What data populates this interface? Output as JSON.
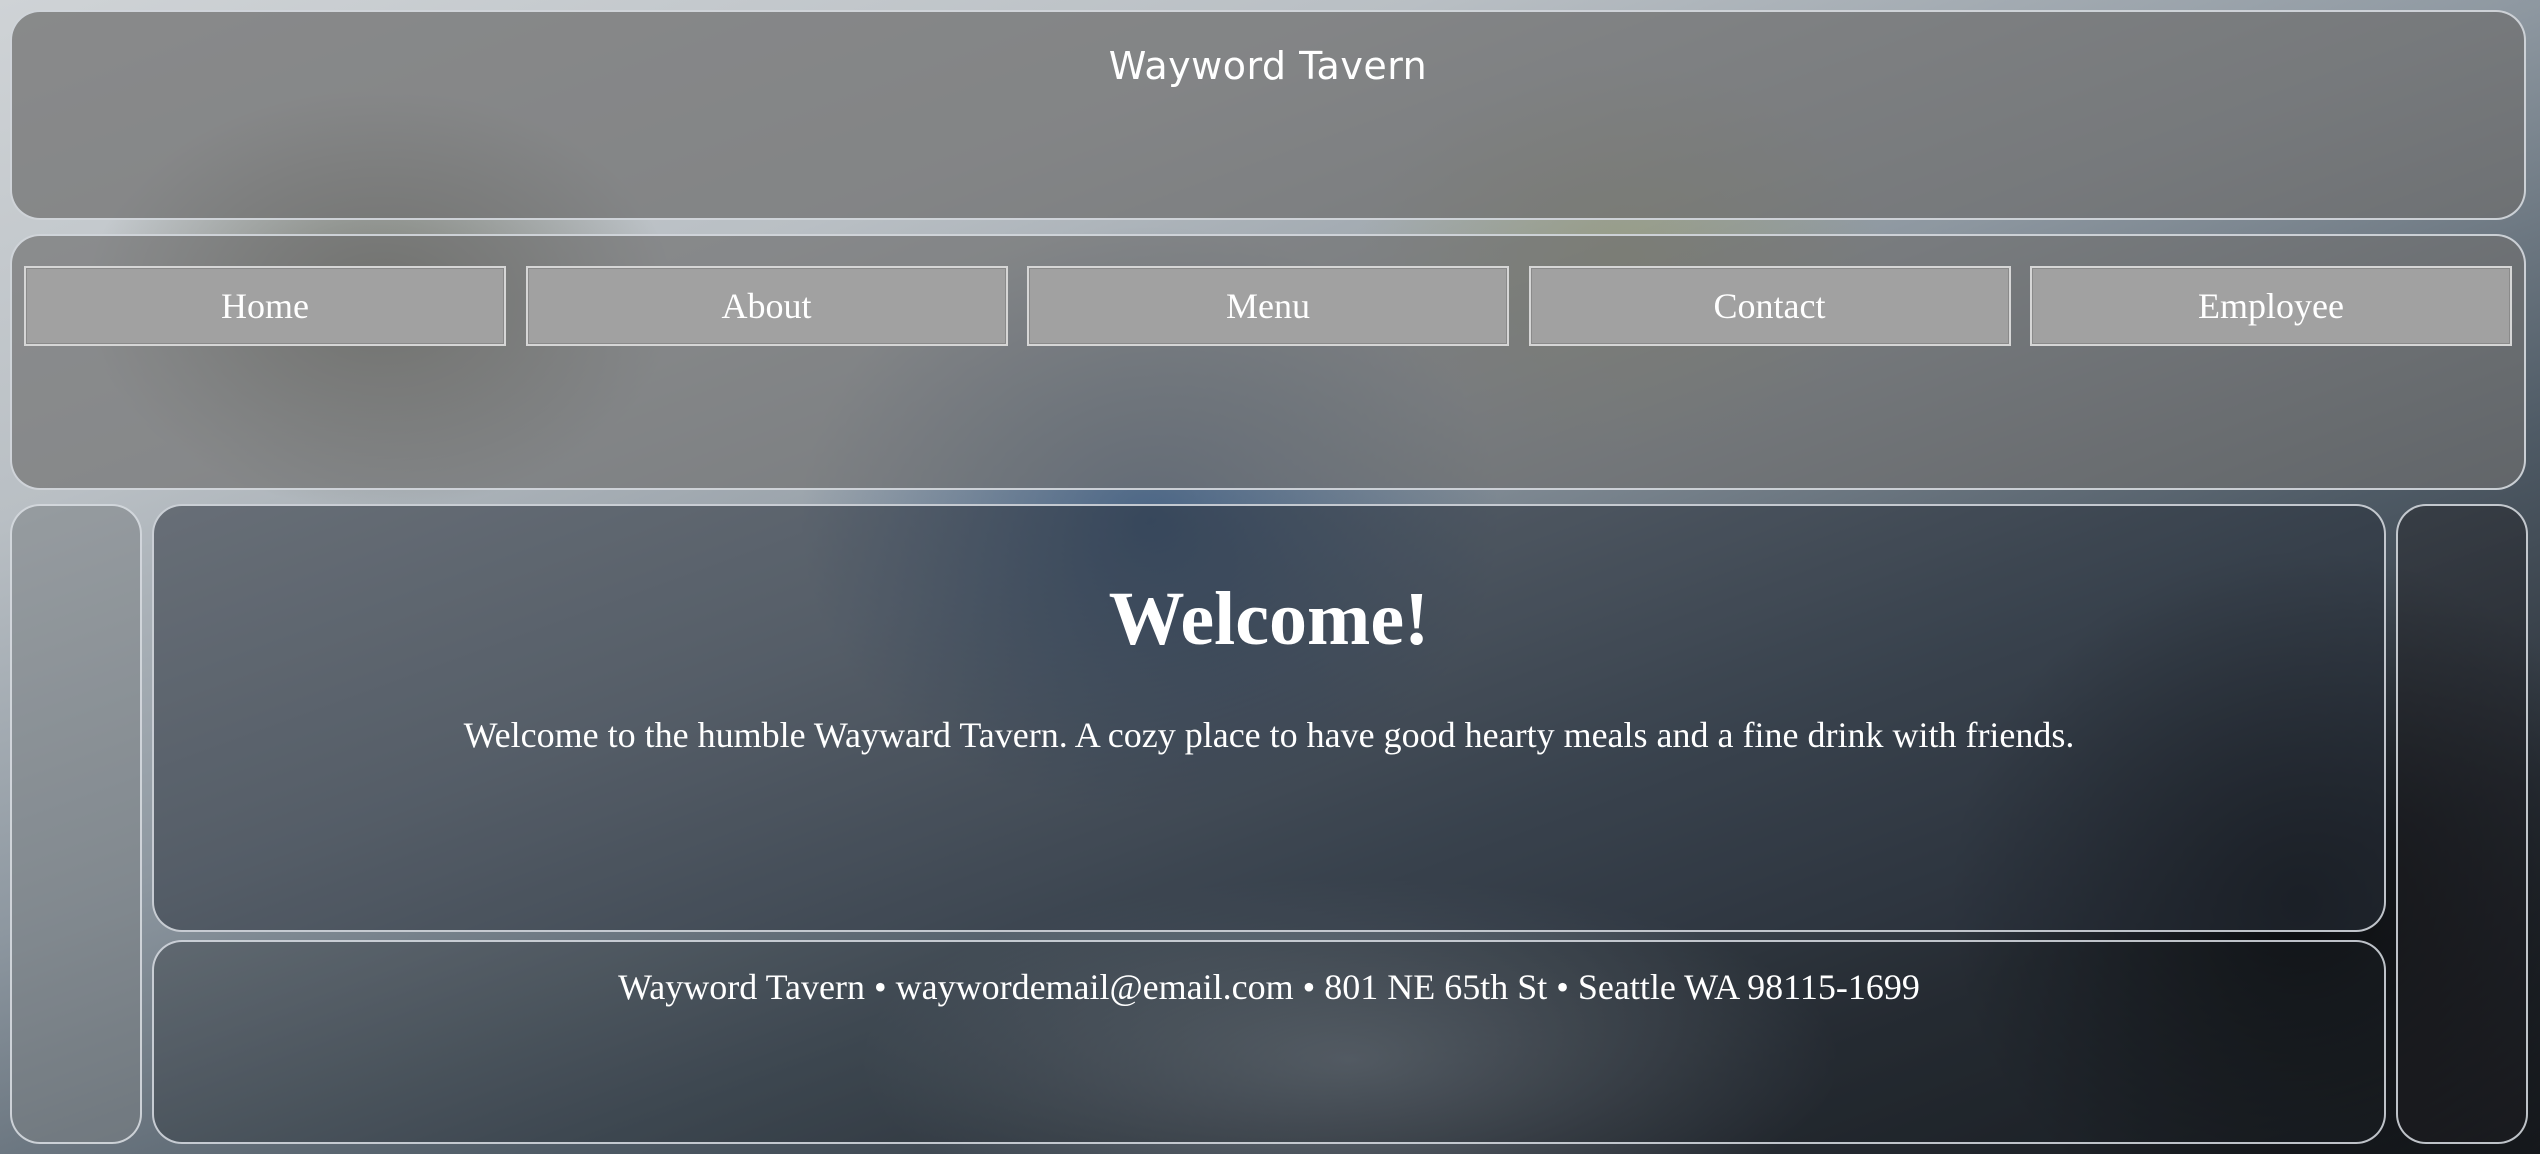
{
  "header": {
    "title": "Wayword Tavern"
  },
  "nav": {
    "items": [
      {
        "label": "Home"
      },
      {
        "label": "About"
      },
      {
        "label": "Menu"
      },
      {
        "label": "Contact"
      },
      {
        "label": "Employee"
      }
    ]
  },
  "main": {
    "heading": "Welcome!",
    "text": "Welcome to the humble Wayward Tavern. A cozy place to have good hearty meals and a fine drink with friends."
  },
  "footer": {
    "text": "Wayword Tavern • waywordemail@email.com • 801 NE 65th St • Seattle WA 98115-1699"
  },
  "colors": {
    "panel_border": "#dce1e6",
    "nav_button_bg": "#a1a1a1",
    "text": "#ffffff"
  }
}
